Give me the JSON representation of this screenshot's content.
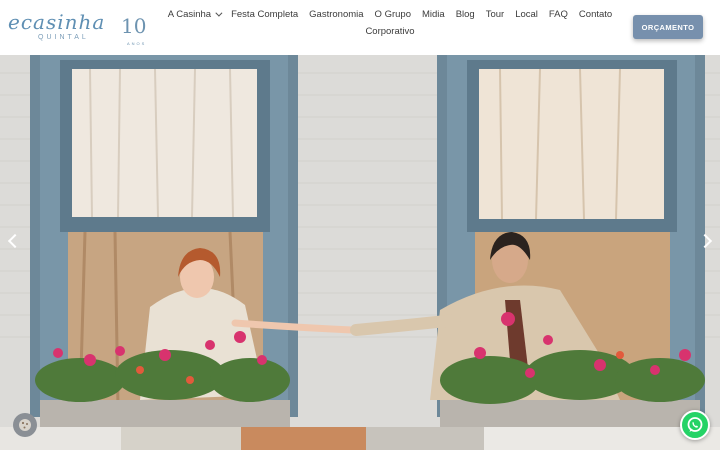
{
  "logo": {
    "script": "ecasinha",
    "subtitle": "QUINTAL",
    "years": "10",
    "years_label": "ANOS"
  },
  "nav": {
    "items": [
      {
        "label": "A Casinha",
        "has_dropdown": true
      },
      {
        "label": "Festa Completa"
      },
      {
        "label": "Gastronomia"
      },
      {
        "label": "O Grupo"
      },
      {
        "label": "Midia"
      },
      {
        "label": "Blog"
      },
      {
        "label": "Tour"
      },
      {
        "label": "Local"
      },
      {
        "label": "FAQ"
      },
      {
        "label": "Contato"
      },
      {
        "label": "Corporativo"
      }
    ]
  },
  "cta": {
    "label": "ORÇAMENTO",
    "color": "#7790ad"
  },
  "hero": {
    "image": "photo-couple-holding-hands-between-windows",
    "prev_icon": "chevron-left-icon",
    "next_icon": "chevron-right-icon"
  },
  "floating": {
    "cookie_icon": "cookie-icon",
    "whatsapp_icon": "whatsapp-icon",
    "whatsapp_color": "#25d366"
  },
  "colors": {
    "brand": "#5f8fb3",
    "text": "#3c3c3c"
  }
}
